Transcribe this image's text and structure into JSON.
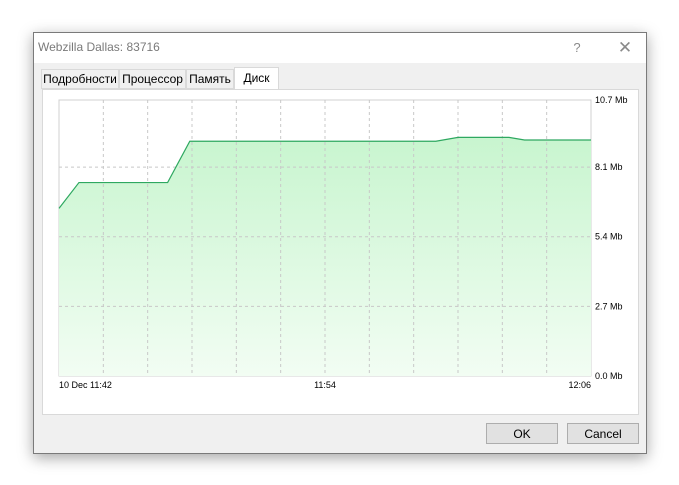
{
  "window": {
    "title": "Webzilla Dallas: 83716",
    "help_glyph": "?",
    "close_glyph": "✕"
  },
  "tabs": [
    {
      "label": "Подробности",
      "active": false
    },
    {
      "label": "Процессор",
      "active": false
    },
    {
      "label": "Память",
      "active": false
    },
    {
      "label": "Диск",
      "active": true
    }
  ],
  "buttons": {
    "ok_label": "OK",
    "cancel_label": "Cancel"
  },
  "colors": {
    "line": "#2ea860",
    "fill_top": "#c8f5cf",
    "fill_bottom": "#f2fdf3",
    "grid": "#c8c8c8"
  },
  "chart_data": {
    "type": "area",
    "title": "",
    "xlabel": "",
    "ylabel": "",
    "unit": "Mb",
    "ylim": [
      0,
      10.7
    ],
    "y_ticks": [
      {
        "value": 10.7,
        "label": "10.7 Mb"
      },
      {
        "value": 8.1,
        "label": "8.1 Mb"
      },
      {
        "value": 5.4,
        "label": "5.4 Mb"
      },
      {
        "value": 2.7,
        "label": "2.7 Mb"
      },
      {
        "value": 0.0,
        "label": "0.0 Mb"
      }
    ],
    "x_ticks": [
      {
        "pos": 0.0,
        "label": "10 Dec 11:42"
      },
      {
        "pos": 0.5,
        "label": "11:54"
      },
      {
        "pos": 1.0,
        "label": "12:06"
      }
    ],
    "x_range_minutes": [
      0,
      24
    ],
    "grid": true,
    "series": [
      {
        "values": [
          [
            0.0,
            6.5
          ],
          [
            0.9,
            7.5
          ],
          [
            4.9,
            7.5
          ],
          [
            5.9,
            9.1
          ],
          [
            17.0,
            9.1
          ],
          [
            18.0,
            9.25
          ],
          [
            20.3,
            9.25
          ],
          [
            21.0,
            9.15
          ],
          [
            24.0,
            9.15
          ]
        ]
      }
    ]
  }
}
